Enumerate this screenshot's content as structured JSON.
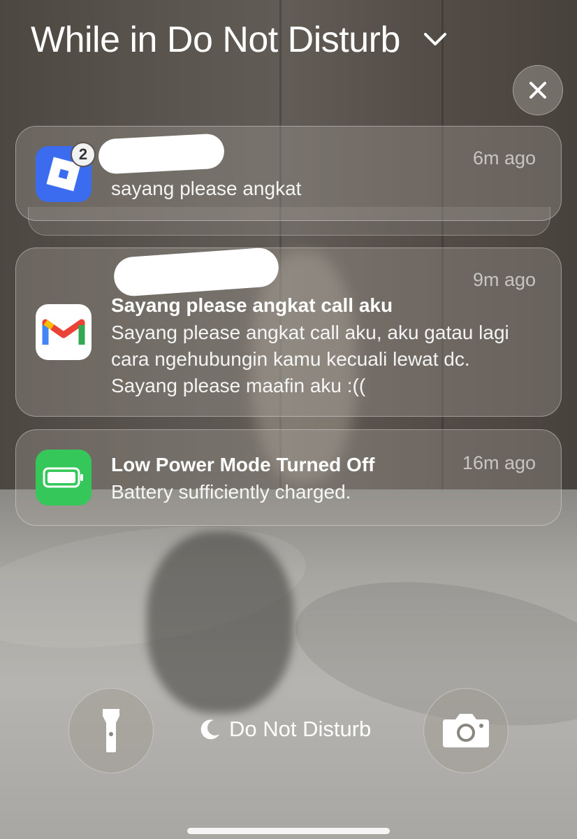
{
  "header": {
    "title": "While in Do Not Disturb",
    "chevron_icon": "chevron-down-icon"
  },
  "close": {
    "icon": "close-icon"
  },
  "notifications": [
    {
      "app_icon": "roblox-icon",
      "badge": "2",
      "time": "6m ago",
      "body": "sayang please angkat"
    },
    {
      "app_icon": "gmail-icon",
      "time": "9m ago",
      "title": "Sayang please angkat call aku",
      "body": "Sayang please angkat call aku, aku gatau lagi cara ngehubungin kamu kecuali lewat dc. Sayang please maafin aku :(("
    },
    {
      "app_icon": "battery-icon",
      "time": "16m ago",
      "title": "Low Power Mode Turned Off",
      "body": "Battery sufficiently charged."
    }
  ],
  "bottom": {
    "flashlight_icon": "flashlight-icon",
    "camera_icon": "camera-icon",
    "focus_icon": "moon-icon",
    "focus_label": "Do Not Disturb"
  },
  "colors": {
    "roblox_blue": "#3b6cf0",
    "battery_green": "#35c759",
    "gmail_red": "#ea4335"
  }
}
